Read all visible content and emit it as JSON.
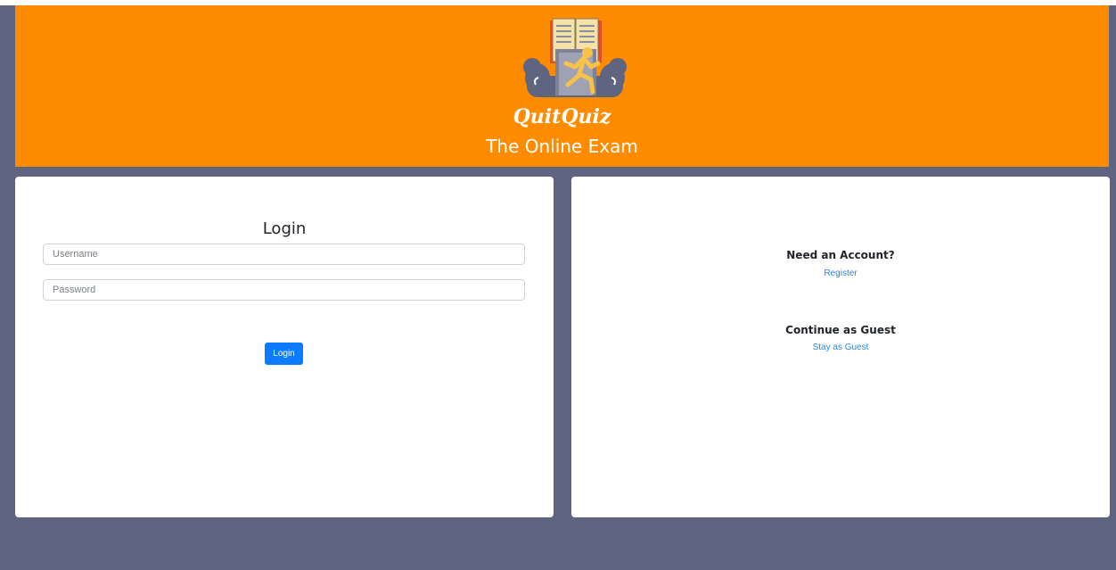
{
  "header": {
    "brand": "QuitQuiz",
    "tagline": "The Online Exam",
    "logo_icon": "book-runner-logo-icon",
    "background_color": "#ff8c00"
  },
  "login": {
    "title": "Login",
    "username_placeholder": "Username",
    "password_placeholder": "Password",
    "button_label": "Login",
    "button_color": "#0b7bff"
  },
  "side": {
    "account_heading": "Need an Account?",
    "register_link": "Register",
    "guest_heading": "Continue as Guest",
    "guest_link": "Stay as Guest",
    "link_color": "#2f86d6"
  },
  "page": {
    "background_color": "#5f6580"
  }
}
